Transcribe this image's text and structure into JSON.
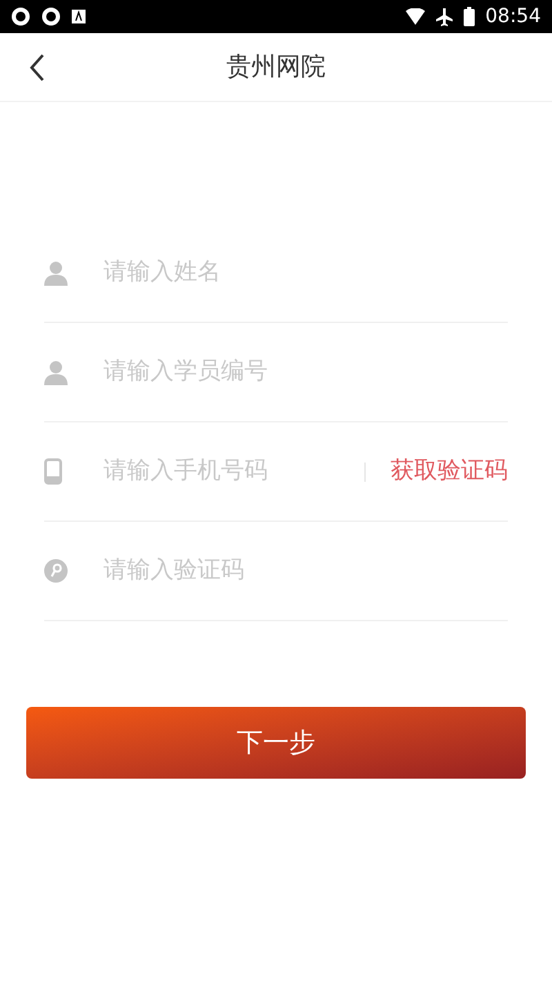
{
  "status_bar": {
    "time": "08:54"
  },
  "header": {
    "title": "贵州网院"
  },
  "fields": [
    {
      "kind": "person",
      "placeholder": "请输入姓名"
    },
    {
      "kind": "person",
      "placeholder": "请输入学员编号"
    },
    {
      "kind": "phone",
      "placeholder": "请输入手机号码",
      "action": "获取验证码"
    },
    {
      "kind": "code",
      "placeholder": "请输入验证码"
    }
  ],
  "submit_button": "下一步"
}
